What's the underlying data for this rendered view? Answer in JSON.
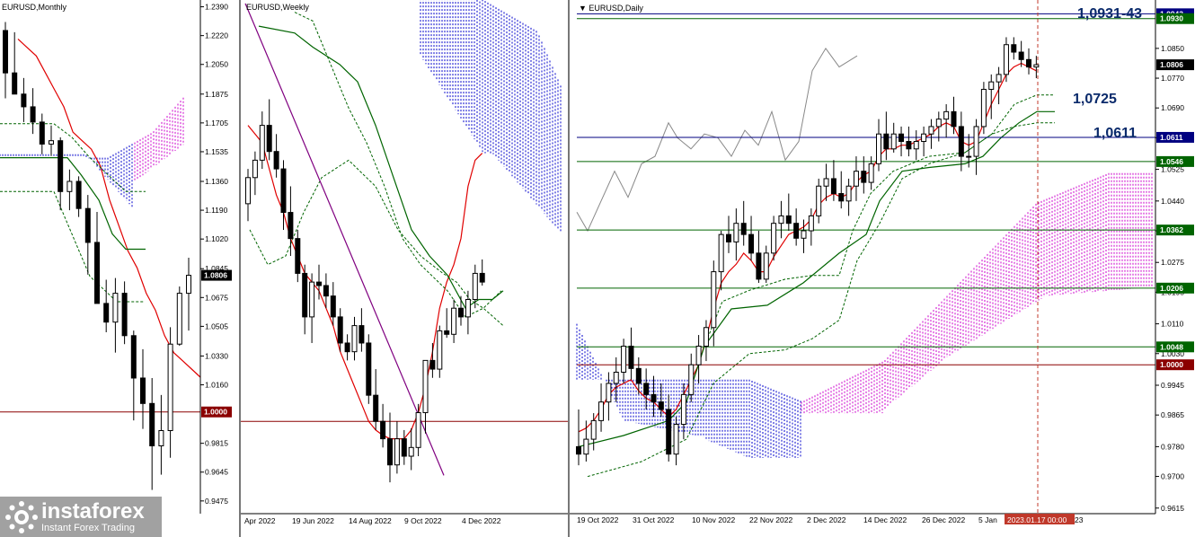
{
  "watermark": {
    "brand": "instaforex",
    "tagline": "Instant Forex Trading"
  },
  "chart_data": [
    {
      "type": "candlestick",
      "title": "EURUSD,Monthly",
      "ylim": [
        0.94,
        1.243
      ],
      "y_ticks": [
        "1.2390",
        "1.2220",
        "1.2050",
        "1.1875",
        "1.1705",
        "1.1535",
        "1.1360",
        "1.1190",
        "1.1020",
        "1.0845",
        "1.0675",
        "1.0505",
        "1.0330",
        "1.0160",
        "0.9815",
        "0.9645",
        "0.9475"
      ],
      "price_labels": [
        {
          "text": "1.0806",
          "value": 1.0806,
          "color": "#000000"
        },
        {
          "text": "1.0000",
          "value": 1.0,
          "color": "#8b0000"
        }
      ],
      "candles": [
        [
          1.225,
          1.23,
          1.185,
          1.2
        ],
        [
          1.2,
          1.224,
          1.189,
          1.1875
        ],
        [
          1.1875,
          1.197,
          1.171,
          1.18
        ],
        [
          1.18,
          1.191,
          1.164,
          1.171
        ],
        [
          1.171,
          1.176,
          1.152,
          1.158
        ],
        [
          1.158,
          1.169,
          1.151,
          1.16
        ],
        [
          1.16,
          1.162,
          1.119,
          1.13
        ],
        [
          1.13,
          1.143,
          1.119,
          1.136
        ],
        [
          1.136,
          1.139,
          1.115,
          1.12
        ],
        [
          1.12,
          1.128,
          1.081,
          1.1
        ],
        [
          1.1,
          1.118,
          1.064,
          1.064
        ],
        [
          1.064,
          1.078,
          1.047,
          1.053
        ],
        [
          1.053,
          1.079,
          1.035,
          1.07
        ],
        [
          1.07,
          1.077,
          1.04,
          1.045
        ],
        [
          1.045,
          1.048,
          0.995,
          1.02
        ],
        [
          1.02,
          1.037,
          0.99,
          1.005
        ],
        [
          1.005,
          1.02,
          0.954,
          0.98
        ],
        [
          0.98,
          1.01,
          0.963,
          0.989
        ],
        [
          0.989,
          1.05,
          0.973,
          1.04
        ],
        [
          1.04,
          1.074,
          1.039,
          1.07
        ],
        [
          1.07,
          1.091,
          1.048,
          1.0806
        ]
      ]
    },
    {
      "type": "candlestick",
      "title": "EURUSD,Weekly",
      "ylim": [
        0.947,
        1.242
      ],
      "x_tick_labels": [
        "Apr 2022",
        "19 Jun 2022",
        "14 Aug 2022",
        "9 Oct 2022",
        "4 Dec 2022"
      ],
      "candles": [
        [
          1.125,
          1.145,
          1.115,
          1.14
        ],
        [
          1.14,
          1.155,
          1.13,
          1.15
        ],
        [
          1.15,
          1.178,
          1.145,
          1.17
        ],
        [
          1.17,
          1.185,
          1.15,
          1.155
        ],
        [
          1.155,
          1.165,
          1.14,
          1.145
        ],
        [
          1.145,
          1.15,
          1.11,
          1.12
        ],
        [
          1.12,
          1.135,
          1.095,
          1.105
        ],
        [
          1.105,
          1.11,
          1.08,
          1.085
        ],
        [
          1.085,
          1.09,
          1.05,
          1.06
        ],
        [
          1.06,
          1.085,
          1.045,
          1.08
        ],
        [
          1.08,
          1.09,
          1.07,
          1.078
        ],
        [
          1.078,
          1.085,
          1.065,
          1.072
        ],
        [
          1.072,
          1.08,
          1.055,
          1.06
        ],
        [
          1.06,
          1.065,
          1.04,
          1.045
        ],
        [
          1.045,
          1.05,
          1.035,
          1.04
        ],
        [
          1.04,
          1.06,
          1.035,
          1.055
        ],
        [
          1.055,
          1.065,
          1.04,
          1.045
        ],
        [
          1.045,
          1.05,
          1.01,
          1.015
        ],
        [
          1.015,
          1.03,
          0.995,
          1.0
        ],
        [
          1.0,
          1.01,
          0.985,
          0.99
        ],
        [
          0.99,
          1.005,
          0.965,
          0.975
        ],
        [
          0.975,
          1.0,
          0.97,
          0.99
        ],
        [
          0.99,
          0.995,
          0.975,
          0.98
        ],
        [
          0.98,
          0.996,
          0.972,
          0.985
        ],
        [
          0.985,
          1.01,
          0.98,
          1.005
        ],
        [
          1.005,
          1.035,
          0.993,
          1.035
        ],
        [
          1.035,
          1.045,
          1.025,
          1.03
        ],
        [
          1.03,
          1.055,
          1.025,
          1.052
        ],
        [
          1.052,
          1.065,
          1.048,
          1.05
        ],
        [
          1.05,
          1.07,
          1.045,
          1.065
        ],
        [
          1.065,
          1.072,
          1.055,
          1.06
        ],
        [
          1.06,
          1.075,
          1.05,
          1.07
        ],
        [
          1.07,
          1.09,
          1.065,
          1.085
        ],
        [
          1.085,
          1.093,
          1.078,
          1.08
        ]
      ]
    },
    {
      "type": "candlestick",
      "title": "EURUSD,Daily",
      "ylim": [
        0.96,
        1.098
      ],
      "y_ticks": [
        "1.0850",
        "1.0770",
        "1.0690",
        "1.0610",
        "1.0525",
        "1.0440",
        "1.0360",
        "1.0275",
        "1.0195",
        "1.0110",
        "1.0030",
        "0.9945",
        "0.9865",
        "0.9780",
        "0.9700",
        "0.9615"
      ],
      "x_tick_labels": [
        "19 Oct 2022",
        "31 Oct 2022",
        "10 Nov 2022",
        "22 Nov 2022",
        "2 Dec 2022",
        "14 Dec 2022",
        "26 Dec 2022",
        "5 Jan",
        "23"
      ],
      "cursor_label": "2023.01.17 00:00",
      "annotations": [
        "1,0931-43",
        "1,0725",
        "1,0611"
      ],
      "levels": [
        {
          "text": "1.0943",
          "value": 1.0943,
          "color": "#000080"
        },
        {
          "text": "1.0930",
          "value": 1.093,
          "color": "#006400"
        },
        {
          "text": "1.0806",
          "value": 1.0806,
          "color": "#000000"
        },
        {
          "text": "1.0611",
          "value": 1.0611,
          "color": "#000080"
        },
        {
          "text": "1.0546",
          "value": 1.0546,
          "color": "#006400"
        },
        {
          "text": "1.0362",
          "value": 1.0362,
          "color": "#006400"
        },
        {
          "text": "1.0206",
          "value": 1.0206,
          "color": "#006400"
        },
        {
          "text": "1.0048",
          "value": 1.0048,
          "color": "#006400"
        },
        {
          "text": "1.0000",
          "value": 1.0,
          "color": "#8b0000"
        }
      ],
      "candles": [
        [
          0.978,
          0.988,
          0.973,
          0.976
        ],
        [
          0.976,
          0.985,
          0.974,
          0.98
        ],
        [
          0.98,
          0.987,
          0.977,
          0.985
        ],
        [
          0.985,
          0.995,
          0.982,
          0.99
        ],
        [
          0.99,
          0.998,
          0.985,
          0.995
        ],
        [
          0.995,
          1.002,
          0.99,
          0.998
        ],
        [
          0.998,
          1.007,
          0.995,
          1.005
        ],
        [
          1.005,
          1.01,
          0.996,
          0.999
        ],
        [
          0.999,
          1.002,
          0.992,
          0.995
        ],
        [
          0.995,
          0.999,
          0.988,
          0.992
        ],
        [
          0.992,
          0.997,
          0.986,
          0.99
        ],
        [
          0.99,
          0.995,
          0.986,
          0.988
        ],
        [
          0.988,
          0.992,
          0.974,
          0.976
        ],
        [
          0.976,
          0.986,
          0.973,
          0.984
        ],
        [
          0.984,
          0.995,
          0.98,
          0.992
        ],
        [
          0.992,
          1.003,
          0.99,
          1.0
        ],
        [
          1.0,
          1.008,
          0.995,
          1.005
        ],
        [
          1.005,
          1.012,
          1.001,
          1.01
        ],
        [
          1.01,
          1.028,
          1.005,
          1.025
        ],
        [
          1.025,
          1.036,
          1.02,
          1.035
        ],
        [
          1.035,
          1.04,
          1.03,
          1.033
        ],
        [
          1.033,
          1.042,
          1.028,
          1.038
        ],
        [
          1.038,
          1.044,
          1.032,
          1.035
        ],
        [
          1.035,
          1.04,
          1.028,
          1.03
        ],
        [
          1.03,
          1.036,
          1.022,
          1.023
        ],
        [
          1.023,
          1.032,
          1.022,
          1.03
        ],
        [
          1.03,
          1.04,
          1.028,
          1.038
        ],
        [
          1.038,
          1.044,
          1.034,
          1.04
        ],
        [
          1.04,
          1.046,
          1.036,
          1.038
        ],
        [
          1.038,
          1.042,
          1.032,
          1.034
        ],
        [
          1.034,
          1.039,
          1.03,
          1.036
        ],
        [
          1.036,
          1.042,
          1.032,
          1.04
        ],
        [
          1.04,
          1.05,
          1.038,
          1.048
        ],
        [
          1.048,
          1.054,
          1.044,
          1.05
        ],
        [
          1.05,
          1.055,
          1.044,
          1.046
        ],
        [
          1.046,
          1.052,
          1.042,
          1.044
        ],
        [
          1.044,
          1.05,
          1.04,
          1.048
        ],
        [
          1.048,
          1.056,
          1.044,
          1.052
        ],
        [
          1.052,
          1.056,
          1.046,
          1.049
        ],
        [
          1.049,
          1.056,
          1.047,
          1.054
        ],
        [
          1.054,
          1.066,
          1.052,
          1.062
        ],
        [
          1.062,
          1.068,
          1.055,
          1.058
        ],
        [
          1.058,
          1.065,
          1.057,
          1.062
        ],
        [
          1.062,
          1.064,
          1.056,
          1.06
        ],
        [
          1.06,
          1.064,
          1.056,
          1.058
        ],
        [
          1.058,
          1.063,
          1.055,
          1.06
        ],
        [
          1.06,
          1.064,
          1.056,
          1.062
        ],
        [
          1.062,
          1.066,
          1.058,
          1.064
        ],
        [
          1.064,
          1.068,
          1.06,
          1.066
        ],
        [
          1.066,
          1.07,
          1.061,
          1.068
        ],
        [
          1.068,
          1.072,
          1.062,
          1.064
        ],
        [
          1.064,
          1.068,
          1.052,
          1.056
        ],
        [
          1.056,
          1.062,
          1.053,
          1.056
        ],
        [
          1.056,
          1.066,
          1.051,
          1.064
        ],
        [
          1.064,
          1.076,
          1.062,
          1.074
        ],
        [
          1.074,
          1.078,
          1.066,
          1.076
        ],
        [
          1.076,
          1.08,
          1.07,
          1.078
        ],
        [
          1.078,
          1.088,
          1.076,
          1.086
        ],
        [
          1.086,
          1.088,
          1.082,
          1.084
        ],
        [
          1.084,
          1.087,
          1.08,
          1.082
        ],
        [
          1.082,
          1.085,
          1.078,
          1.08
        ],
        [
          1.08,
          1.083,
          1.077,
          1.0806
        ]
      ]
    }
  ]
}
